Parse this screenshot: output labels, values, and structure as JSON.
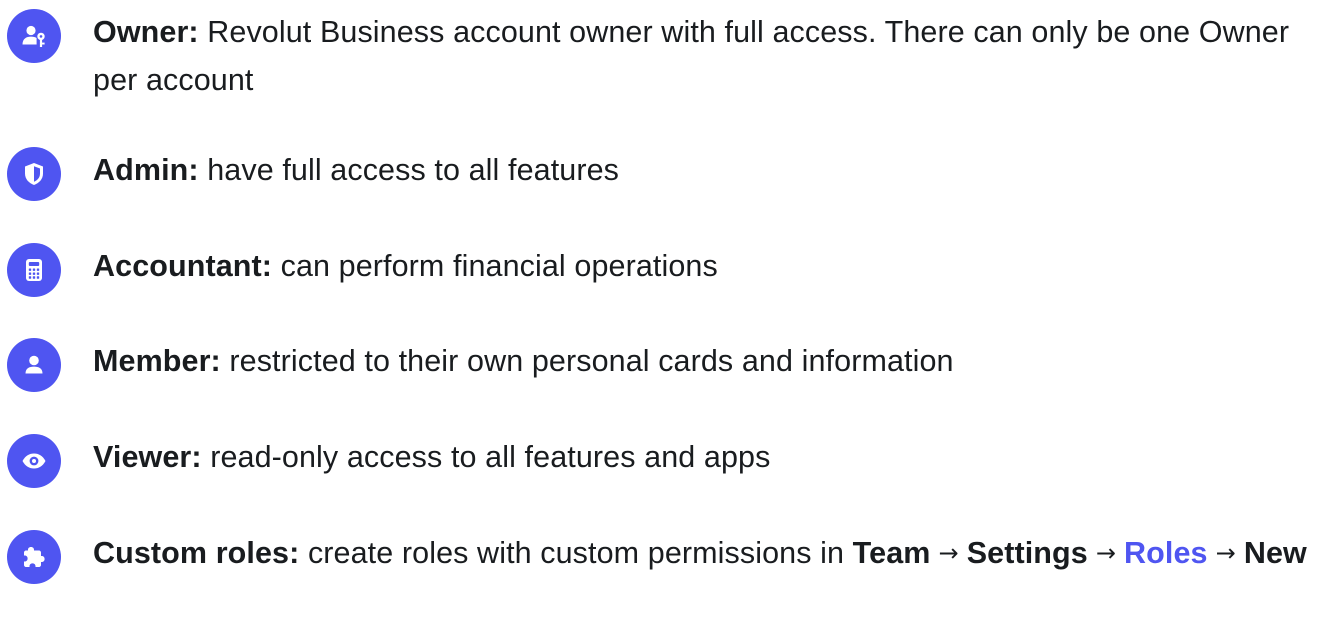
{
  "roles": [
    {
      "name": "Owner:",
      "description": "Revolut Business account owner with full access. There can only be one Owner per account",
      "icon": "user-key-icon"
    },
    {
      "name": "Admin:",
      "description": "have full access to all features",
      "icon": "shield-icon"
    },
    {
      "name": "Accountant:",
      "description": "can perform financial operations",
      "icon": "calculator-icon"
    },
    {
      "name": "Member:",
      "description": "restricted to their own personal cards and information",
      "icon": "person-icon"
    },
    {
      "name": "Viewer:",
      "description": "read-only access to all features and apps",
      "icon": "eye-icon"
    },
    {
      "name": "Custom roles:",
      "description": "create roles with custom permissions in",
      "icon": "puzzle-icon",
      "path": [
        {
          "label": "Team",
          "link": false
        },
        {
          "label": "Settings",
          "link": false
        },
        {
          "label": "Roles",
          "link": true
        },
        {
          "label": "New",
          "link": false
        }
      ],
      "separator": "→"
    }
  ],
  "colors": {
    "accent": "#4f55f1",
    "text": "#191c1f",
    "background": "#ffffff"
  }
}
